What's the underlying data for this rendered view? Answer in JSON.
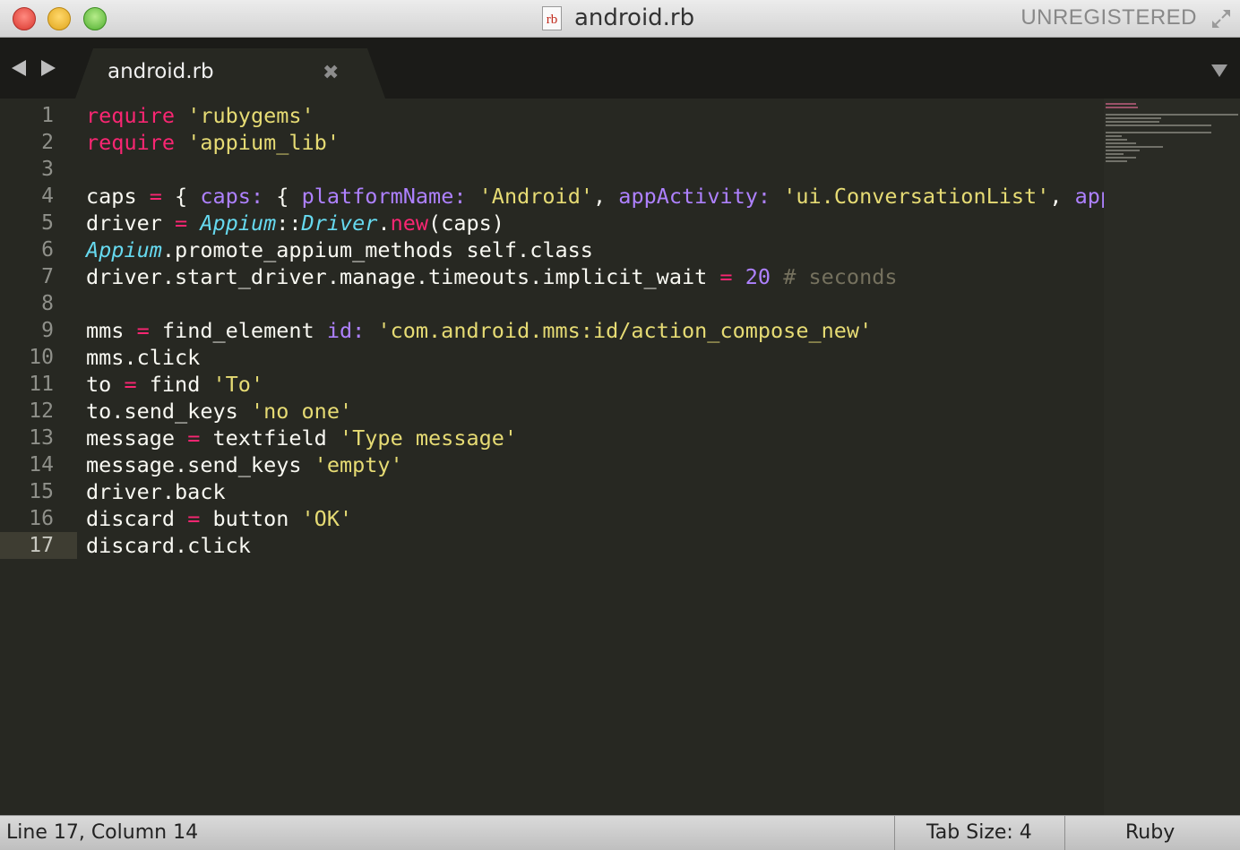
{
  "window": {
    "title": "android.rb",
    "file_icon_text": "rb",
    "registration": "UNREGISTERED"
  },
  "tabs": [
    {
      "label": "android.rb",
      "close_glyph": "✖"
    }
  ],
  "editor": {
    "current_line": 17,
    "line_numbers": [
      "1",
      "2",
      "3",
      "4",
      "5",
      "6",
      "7",
      "8",
      "9",
      "10",
      "11",
      "12",
      "13",
      "14",
      "15",
      "16",
      "17"
    ]
  },
  "code": {
    "l1": {
      "t0": "require",
      "t1": " ",
      "t2": "'rubygems'"
    },
    "l2": {
      "t0": "require",
      "t1": " ",
      "t2": "'appium_lib'"
    },
    "l4": {
      "t0": "caps ",
      "t1": "=",
      "t2": " { ",
      "t3": "caps:",
      "t4": " { ",
      "t5": "platformName:",
      "t6": " ",
      "t7": "'Android'",
      "t8": ", ",
      "t9": "appActivity:",
      "t10": " ",
      "t11": "'ui.ConversationList'",
      "t12": ", ",
      "t13": "appl"
    },
    "l5": {
      "t0": "driver ",
      "t1": "=",
      "t2": " ",
      "t3": "Appium",
      "t4": "::",
      "t5": "Driver",
      "t6": ".",
      "t7": "new",
      "t8": "(caps)"
    },
    "l6": {
      "t0": "Appium",
      "t1": ".promote_appium_methods self.class"
    },
    "l7": {
      "t0": "driver.start_driver.manage.timeouts.implicit_wait ",
      "t1": "=",
      "t2": " ",
      "t3": "20",
      "t4": " ",
      "t5": "# seconds"
    },
    "l9": {
      "t0": "mms ",
      "t1": "=",
      "t2": " find_element ",
      "t3": "id:",
      "t4": " ",
      "t5": "'com.android.mms:id/action_compose_new'"
    },
    "l10": {
      "t0": "mms.click"
    },
    "l11": {
      "t0": "to ",
      "t1": "=",
      "t2": " find ",
      "t3": "'To'"
    },
    "l12": {
      "t0": "to.send_keys ",
      "t1": "'no one'"
    },
    "l13": {
      "t0": "message ",
      "t1": "=",
      "t2": " textfield ",
      "t3": "'Type message'"
    },
    "l14": {
      "t0": "message.send_keys ",
      "t1": "'empty'"
    },
    "l15": {
      "t0": "driver.back"
    },
    "l16": {
      "t0": "discard ",
      "t1": "=",
      "t2": " button ",
      "t3": "'OK'"
    },
    "l17": {
      "t0": "discard.click"
    }
  },
  "status": {
    "position": "Line 17, Column 14",
    "tab_size": "Tab Size: 4",
    "syntax": "Ruby"
  },
  "colors": {
    "background": "#272822",
    "keyword": "#f92672",
    "string": "#e6db74",
    "symbol": "#ae81ff",
    "class": "#66d9ef",
    "comment": "#75715e"
  }
}
